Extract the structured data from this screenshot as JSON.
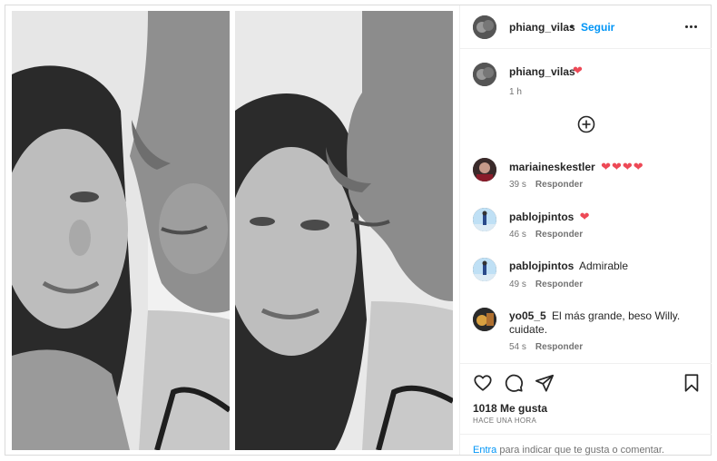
{
  "post": {
    "author": "phiang_vilas",
    "follow_label": "Seguir",
    "separator": "•",
    "caption_heart": "❤",
    "caption_time": "1 h"
  },
  "comments": [
    {
      "user": "mariaineskestler",
      "text": "",
      "emoji": "❤❤❤❤",
      "age": "39 s",
      "reply": "Responder"
    },
    {
      "user": "pablojpintos",
      "text": "",
      "emoji": "❤",
      "age": "46 s",
      "reply": "Responder"
    },
    {
      "user": "pablojpintos",
      "text": "Admirable",
      "emoji": "",
      "age": "49 s",
      "reply": "Responder"
    },
    {
      "user": "yo05_5",
      "text": "El más grande, beso Willy. cuidate.",
      "emoji": "",
      "age": "54 s",
      "reply": "Responder"
    }
  ],
  "stats": {
    "likes": "1018 Me gusta",
    "posted": "HACE UNA HORA"
  },
  "login_prompt": {
    "link": "Entra",
    "text": " para indicar que te gusta o comentar."
  },
  "icons": {
    "more": "more-options-icon",
    "plus": "load-more-comments-icon",
    "like": "heart-outline-icon",
    "comment": "comment-bubble-icon",
    "share": "paper-plane-icon",
    "save": "bookmark-icon"
  },
  "colors": {
    "accent": "#0095f6",
    "heart": "#ed4956",
    "text": "#262626",
    "muted": "#737373"
  }
}
